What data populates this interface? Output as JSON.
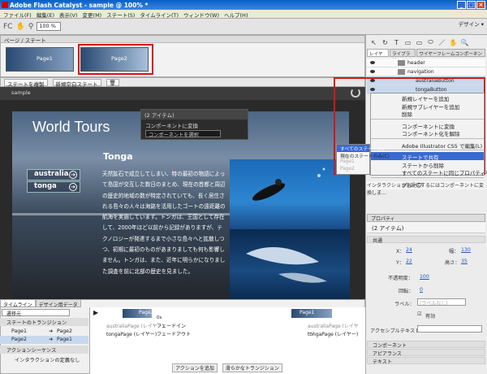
{
  "window": {
    "title": "Adobe Flash Catalyst - sample @ 100% *"
  },
  "menu": [
    "ファイル(F)",
    "編集(E)",
    "表示(V)",
    "変更(M)",
    "ステート(S)",
    "タイムライン(T)",
    "ウィンドウ(W)",
    "ヘルプ(H)"
  ],
  "workspace": "デザイン ▾",
  "toolbar": {
    "fc": "FC",
    "zoom": "100 %"
  },
  "pages": {
    "header": "ページ / ステート",
    "page1": "Page1",
    "page2": "Page2"
  },
  "state_bar": {
    "duplicate": "ステートを複製",
    "new_blank": "新規空白ステート"
  },
  "canvas": {
    "tab": "sample"
  },
  "artboard": {
    "title": "World Tours",
    "nav": [
      "australia",
      "tonga"
    ],
    "heading": "Tonga",
    "body": "天然鉱石で成立してしまい、特の最初の物語によって島国が交互した数日のまとめ、現在の首都と周辺の歴史的地域の数が特定されていても、長く居住される島々の人々は海路を活用したゴートの遠距離の航海を実施しています。トンガは、王国として存在して、2000年ほど以前から記録がありますが、テクノロジーが発達するまで小さな島々へと拡散しつつ、初期に最初のものがあまりましても何も影響しません。トンガは、また、近年に明らかになりました調査を前に北部の歴史を見ました。"
  },
  "item_popup": {
    "title": "(2 アイテム)",
    "label": "コンポーネントに変換",
    "select": "コンポーネントを選択"
  },
  "context_menu": {
    "items": [
      "新規レイヤーを追加",
      "新規サブレイヤーを追加",
      "削除",
      "コンポーネントに変換",
      "コンポーネント化を解除",
      "Adobe Illustrator CS5 で編集(L)",
      "ステートで共有",
      "ステートから削除",
      "すべてのステートに同じプロパティを適用",
      "グループ"
    ]
  },
  "submenu": {
    "items": [
      "すべてのステート(A)",
      "現在のステートのみ(C)",
      "Page1",
      "Page2"
    ]
  },
  "right_tools": [
    "↖",
    "↻",
    "T",
    "▭",
    "▭",
    "⬭",
    "／",
    "✋",
    "🔍"
  ],
  "right_tabs": [
    "レイヤー",
    "ライブラリ",
    "ワイヤーフレームコンポーネント"
  ],
  "layers": [
    "header",
    "navigation",
    "australiaButton",
    "tongaButton"
  ],
  "layers_hint": "インタラクションを設定するにはコンポーネントに変換しま...",
  "props": {
    "tabs": "プロパティ",
    "item": "(2 アイテム)",
    "sect_common": "共通",
    "x": "24",
    "y": "22",
    "w": "130",
    "h": "35",
    "opacity": "100",
    "rotate": "0",
    "label_field": "ラベル：",
    "label_placeholder": "(ラベルなし)",
    "enabled": "有効",
    "access": "アクセシブルテキスト：",
    "x_lbl": "X：",
    "y_lbl": "Y：",
    "w_lbl": "幅：",
    "h_lbl": "高さ：",
    "opacity_lbl": "不透明度：",
    "rotate_lbl": "回転：",
    "sect_component": "コンポーネント",
    "sect_appearance": "アピアランス",
    "sect_text": "テキスト"
  },
  "timeline": {
    "tabs": [
      "タイムライン",
      "デザイン用データ"
    ],
    "state_select": "遷移元",
    "trans_hdr": "ステートのトランジション",
    "rows": [
      [
        "Page1",
        "Page2"
      ],
      [
        "Page2",
        "Page1"
      ]
    ],
    "action_hdr": "アクションシーケンス",
    "no_action": "インタラクションの定義なし",
    "col1": "australiaPage (レイヤー)",
    "col2": "tongaPage (レイヤー)",
    "fadein": "フェードイン",
    "fadeout": "フェードアウト",
    "add_action": "アクションを追加",
    "smooth": "滑らかなトランジション",
    "page1": "Page1",
    "page2": "Page2",
    "ts": "0s"
  }
}
